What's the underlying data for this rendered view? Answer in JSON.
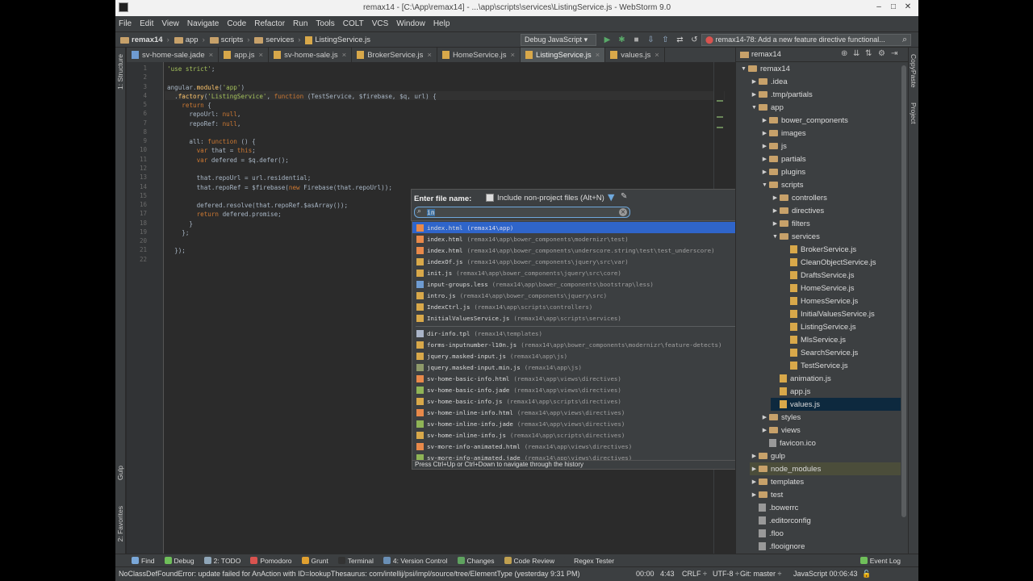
{
  "window": {
    "title": "remax14 - [C:\\App\\remax14] - ...\\app\\scripts\\services\\ListingService.js - WebStorm 9.0",
    "minimize": "–",
    "maximize": "□",
    "close": "✕"
  },
  "menu": [
    "File",
    "Edit",
    "View",
    "Navigate",
    "Code",
    "Refactor",
    "Run",
    "Tools",
    "COLT",
    "VCS",
    "Window",
    "Help"
  ],
  "breadcrumbs": [
    "remax14",
    "app",
    "scripts",
    "services",
    "ListingService.js"
  ],
  "toolbar": {
    "run_config": "Debug JavaScript",
    "task": "remax14-78: Add a new feature directive functional..."
  },
  "tabs": [
    {
      "label": "sv-home-sale.jade",
      "type": "jade"
    },
    {
      "label": "app.js",
      "type": "js"
    },
    {
      "label": "sv-home-sale.js",
      "type": "js"
    },
    {
      "label": "BrokerService.js",
      "type": "js"
    },
    {
      "label": "HomeService.js",
      "type": "js"
    },
    {
      "label": "ListingService.js",
      "type": "js",
      "active": true
    },
    {
      "label": "values.js",
      "type": "js"
    }
  ],
  "code": {
    "line_numbers": [
      "1",
      "2",
      "3",
      "4",
      "5",
      "6",
      "7",
      "8",
      "9",
      "10",
      "11",
      "12",
      "13",
      "14",
      "15",
      "16",
      "17",
      "18",
      "19",
      "20",
      "21",
      "22"
    ],
    "lines": [
      "'use strict';",
      "",
      "angular.module('app')",
      "  .factory('ListingService', function (TestService, $firebase, $q, url) {",
      "    return {",
      "      repoUrl: null,",
      "      repoRef: null,",
      "",
      "      all: function () {",
      "        var that = this;",
      "        var defered = $q.defer();",
      "",
      "        that.repoUrl = url.residential;",
      "        that.repoRef = $firebase(new Firebase(that.repoUrl));",
      "",
      "        defered.resolve(that.repoRef.$asArray());",
      "        return defered.promise;",
      "      }",
      "    };",
      "",
      "  });",
      ""
    ]
  },
  "goto_file": {
    "label": "Enter file name:",
    "include_label": "Include non-project files (Alt+N)",
    "query": "in",
    "hint": "Press Ctrl+Up or Ctrl+Down to navigate through the history",
    "results": [
      {
        "name": "index.html",
        "path": "(remax14\\app)",
        "color": "#e8894a",
        "selected": true
      },
      {
        "name": "index.html",
        "path": "(remax14\\app\\bower_components\\modernizr\\test)",
        "color": "#e8894a"
      },
      {
        "name": "index.html",
        "path": "(remax14\\app\\bower_components\\underscore.string\\test\\test_underscore)",
        "color": "#e8894a"
      },
      {
        "name": "indexOf.js",
        "path": "(remax14\\app\\bower_components\\jquery\\src\\var)",
        "color": "#d8a84a"
      },
      {
        "name": "init.js",
        "path": "(remax14\\app\\bower_components\\jquery\\src\\core)",
        "color": "#d8a84a"
      },
      {
        "name": "input-groups.less",
        "path": "(remax14\\app\\bower_components\\bootstrap\\less)",
        "color": "#6e9bd1"
      },
      {
        "name": "intro.js",
        "path": "(remax14\\app\\bower_components\\jquery\\src)",
        "color": "#d8a84a"
      },
      {
        "name": "IndexCtrl.js",
        "path": "(remax14\\app\\scripts\\controllers)",
        "color": "#d8a84a"
      },
      {
        "name": "InitialValuesService.js",
        "path": "(remax14\\app\\scripts\\services)",
        "color": "#d8a84a"
      },
      {
        "name": "dir-info.tpl",
        "path": "(remax14\\templates)",
        "color": "#aab4c8"
      },
      {
        "name": "forms-inputnumber-l10n.js",
        "path": "(remax14\\app\\bower_components\\modernizr\\feature-detects)",
        "color": "#d8a84a"
      },
      {
        "name": "jquery.masked-input.js",
        "path": "(remax14\\app\\js)",
        "color": "#d8a84a"
      },
      {
        "name": "jquery.masked-input.min.js",
        "path": "(remax14\\app\\js)",
        "color": "#8f9a6a"
      },
      {
        "name": "sv-home-basic-info.html",
        "path": "(remax14\\app\\views\\directives)",
        "color": "#e8894a"
      },
      {
        "name": "sv-home-basic-info.jade",
        "path": "(remax14\\app\\views\\directives)",
        "color": "#8fb456"
      },
      {
        "name": "sv-home-basic-info.js",
        "path": "(remax14\\app\\scripts\\directives)",
        "color": "#d8a84a"
      },
      {
        "name": "sv-home-inline-info.html",
        "path": "(remax14\\app\\views\\directives)",
        "color": "#e8894a"
      },
      {
        "name": "sv-home-inline-info.jade",
        "path": "(remax14\\app\\views\\directives)",
        "color": "#8fb456"
      },
      {
        "name": "sv-home-inline-info.js",
        "path": "(remax14\\app\\scripts\\directives)",
        "color": "#d8a84a"
      },
      {
        "name": "sv-more-info-animated.html",
        "path": "(remax14\\app\\views\\directives)",
        "color": "#e8894a"
      },
      {
        "name": "sv-more-info-animated.jade",
        "path": "(remax14\\app\\views\\directives)",
        "color": "#8fb456"
      }
    ]
  },
  "project": {
    "header": "remax14",
    "tree": [
      {
        "label": "remax14",
        "depth": 0,
        "kind": "folder",
        "open": true
      },
      {
        "label": ".idea",
        "depth": 1,
        "kind": "folder"
      },
      {
        "label": ".tmp/partials",
        "depth": 1,
        "kind": "folder"
      },
      {
        "label": "app",
        "depth": 1,
        "kind": "folder",
        "open": true
      },
      {
        "label": "bower_components",
        "depth": 2,
        "kind": "folder"
      },
      {
        "label": "images",
        "depth": 2,
        "kind": "folder"
      },
      {
        "label": "js",
        "depth": 2,
        "kind": "folder"
      },
      {
        "label": "partials",
        "depth": 2,
        "kind": "folder"
      },
      {
        "label": "plugins",
        "depth": 2,
        "kind": "folder"
      },
      {
        "label": "scripts",
        "depth": 2,
        "kind": "folder",
        "open": true
      },
      {
        "label": "controllers",
        "depth": 3,
        "kind": "folder"
      },
      {
        "label": "directives",
        "depth": 3,
        "kind": "folder"
      },
      {
        "label": "filters",
        "depth": 3,
        "kind": "folder"
      },
      {
        "label": "services",
        "depth": 3,
        "kind": "folder",
        "open": true
      },
      {
        "label": "BrokerService.js",
        "depth": 4,
        "kind": "js"
      },
      {
        "label": "CleanObjectService.js",
        "depth": 4,
        "kind": "js"
      },
      {
        "label": "DraftsService.js",
        "depth": 4,
        "kind": "js"
      },
      {
        "label": "HomeService.js",
        "depth": 4,
        "kind": "js"
      },
      {
        "label": "HomesService.js",
        "depth": 4,
        "kind": "js"
      },
      {
        "label": "InitialValuesService.js",
        "depth": 4,
        "kind": "js"
      },
      {
        "label": "ListingService.js",
        "depth": 4,
        "kind": "js"
      },
      {
        "label": "MlsService.js",
        "depth": 4,
        "kind": "js"
      },
      {
        "label": "SearchService.js",
        "depth": 4,
        "kind": "js"
      },
      {
        "label": "TestService.js",
        "depth": 4,
        "kind": "js"
      },
      {
        "label": "animation.js",
        "depth": 3,
        "kind": "js"
      },
      {
        "label": "app.js",
        "depth": 3,
        "kind": "js"
      },
      {
        "label": "values.js",
        "depth": 3,
        "kind": "js",
        "highlight": "sel"
      },
      {
        "label": "styles",
        "depth": 2,
        "kind": "folder"
      },
      {
        "label": "views",
        "depth": 2,
        "kind": "folder"
      },
      {
        "label": "favicon.ico",
        "depth": 2,
        "kind": "other"
      },
      {
        "label": "gulp",
        "depth": 1,
        "kind": "folder"
      },
      {
        "label": "node_modules",
        "depth": 1,
        "kind": "folder",
        "highlight": "lib"
      },
      {
        "label": "templates",
        "depth": 1,
        "kind": "folder"
      },
      {
        "label": "test",
        "depth": 1,
        "kind": "folder"
      },
      {
        "label": ".bowerrc",
        "depth": 1,
        "kind": "other"
      },
      {
        "label": ".editorconfig",
        "depth": 1,
        "kind": "other"
      },
      {
        "label": ".floo",
        "depth": 1,
        "kind": "other"
      },
      {
        "label": ".flooignore",
        "depth": 1,
        "kind": "other"
      }
    ]
  },
  "side_tabs": {
    "structure": "1: Structure",
    "gulp": "Gulp",
    "favorites": "2: Favorites",
    "copy_paste": "CopyPaste",
    "project": "Project"
  },
  "tool_windows": [
    {
      "label": "Find",
      "color": "#7aa7d8"
    },
    {
      "label": "Debug",
      "color": "#6fbf5a"
    },
    {
      "label": "2: TODO",
      "color": "#8fa6b8"
    },
    {
      "label": "Pomodoro",
      "color": "#d9534f"
    },
    {
      "label": "Grunt",
      "color": "#e0a030"
    },
    {
      "label": "Terminal",
      "color": "#333"
    },
    {
      "label": "4: Version Control",
      "color": "#6a8fb5"
    },
    {
      "label": "Changes",
      "color": "#5fa35f"
    },
    {
      "label": "Code Review",
      "color": "#c0a050"
    },
    {
      "label": "Regex Tester",
      "color": "#3c3f41"
    }
  ],
  "event_log": "Event Log",
  "status": {
    "message": "NoClassDefFoundError: update failed for AnAction with ID=lookupThesaurus: com/intellij/psi/impl/source/tree/ElementType (yesterday 9:31 PM)",
    "timer": "00:00",
    "position": "4:43",
    "line_sep": "CRLF ÷",
    "encoding": "UTF-8 ÷",
    "git": "Git: master ÷",
    "lang": "JavaScript 00:06:43"
  }
}
